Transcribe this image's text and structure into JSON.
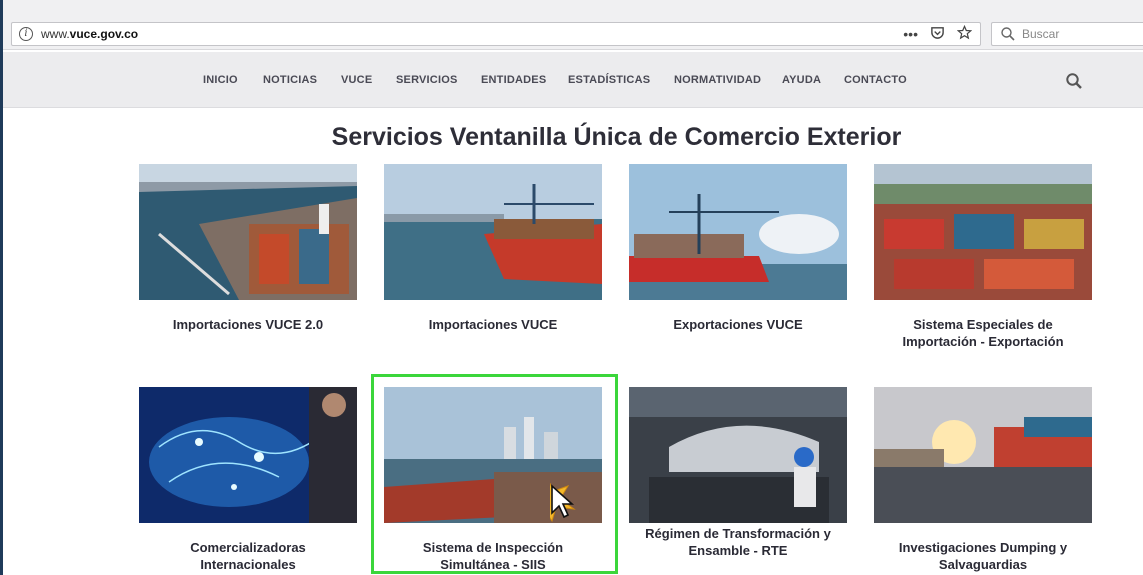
{
  "browser": {
    "url_prefix": "www.",
    "url_domain": "vuce.gov.co",
    "more_icon": "•••",
    "pocket_icon": "pocket-icon",
    "bookmark_icon": "star-icon",
    "search_placeholder": "Buscar"
  },
  "nav": {
    "items": [
      "INICIO",
      "NOTICIAS",
      "VUCE",
      "SERVICIOS",
      "ENTIDADES",
      "ESTADÍSTICAS",
      "NORMATIVIDAD",
      "AYUDA",
      "CONTACTO"
    ]
  },
  "main": {
    "title": "Servicios Ventanilla Única de Comercio Exterior",
    "cards": [
      {
        "line1": "Importaciones VUCE 2.0",
        "line2": ""
      },
      {
        "line1": "Importaciones VUCE",
        "line2": ""
      },
      {
        "line1": "Exportaciones VUCE",
        "line2": ""
      },
      {
        "line1": "Sistema Especiales de",
        "line2": "Importación - Exportación"
      },
      {
        "line1": "Comercializadoras",
        "line2": "Internacionales"
      },
      {
        "line1": "Sistema de Inspección",
        "line2": "Simultánea - SIIS"
      },
      {
        "line1": "Régimen de Transformación y",
        "line2": "Ensamble - RTE"
      },
      {
        "line1": "Investigaciones Dumping y",
        "line2": "Salvaguardias"
      }
    ]
  },
  "colors": {
    "highlight": "#3bd63b",
    "nav_text": "#4a4a55",
    "title_text": "#2e2e38"
  }
}
